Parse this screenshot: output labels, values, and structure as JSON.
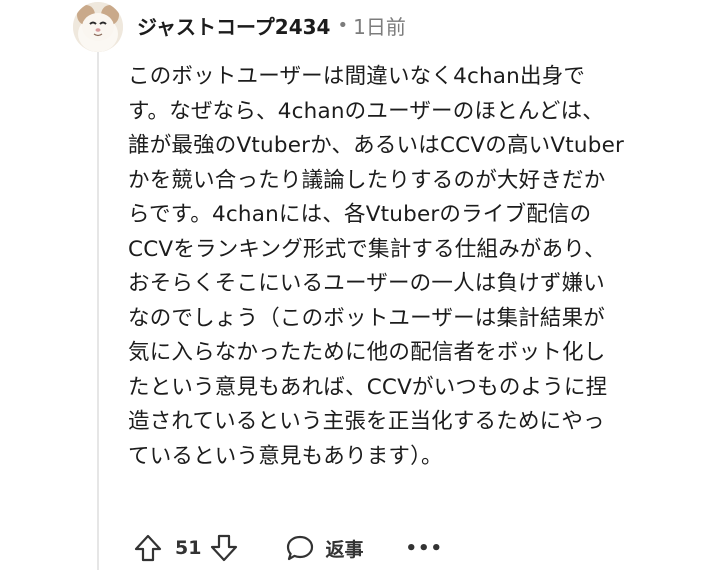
{
  "comment": {
    "author": "ジャストコープ2434",
    "separator": "•",
    "time": "1日前",
    "body_lines": [
      "このボットユーザーは間違いなく4chan出身で",
      "す。なぜなら、4chanのユーザーのほとんどは、",
      "誰が最強のVtuberか、あるいはCCVの高いVtuber",
      "かを競い合ったり議論したりするのが大好きだか",
      "らです。4chanには、各Vtuberのライブ配信の",
      "CCVをランキング形式で集計する仕組みがあり、",
      "おそらくそこにいるユーザーの一人は負けず嫌い",
      "なのでしょう（このボットユーザーは集計結果が",
      "気に入らなかったために他の配信者をボット化し",
      "たという意見もあれば、CCVがいつものように捏",
      "造されているという主張を正当化するためにやっ",
      "ているという意見もあります）。"
    ]
  },
  "actions": {
    "upvote_icon": "arrow-up-outline-icon",
    "score": "51",
    "downvote_icon": "arrow-down-outline-icon",
    "reply_icon": "speech-bubble-icon",
    "reply_label": "返事",
    "more_label": "•••"
  }
}
